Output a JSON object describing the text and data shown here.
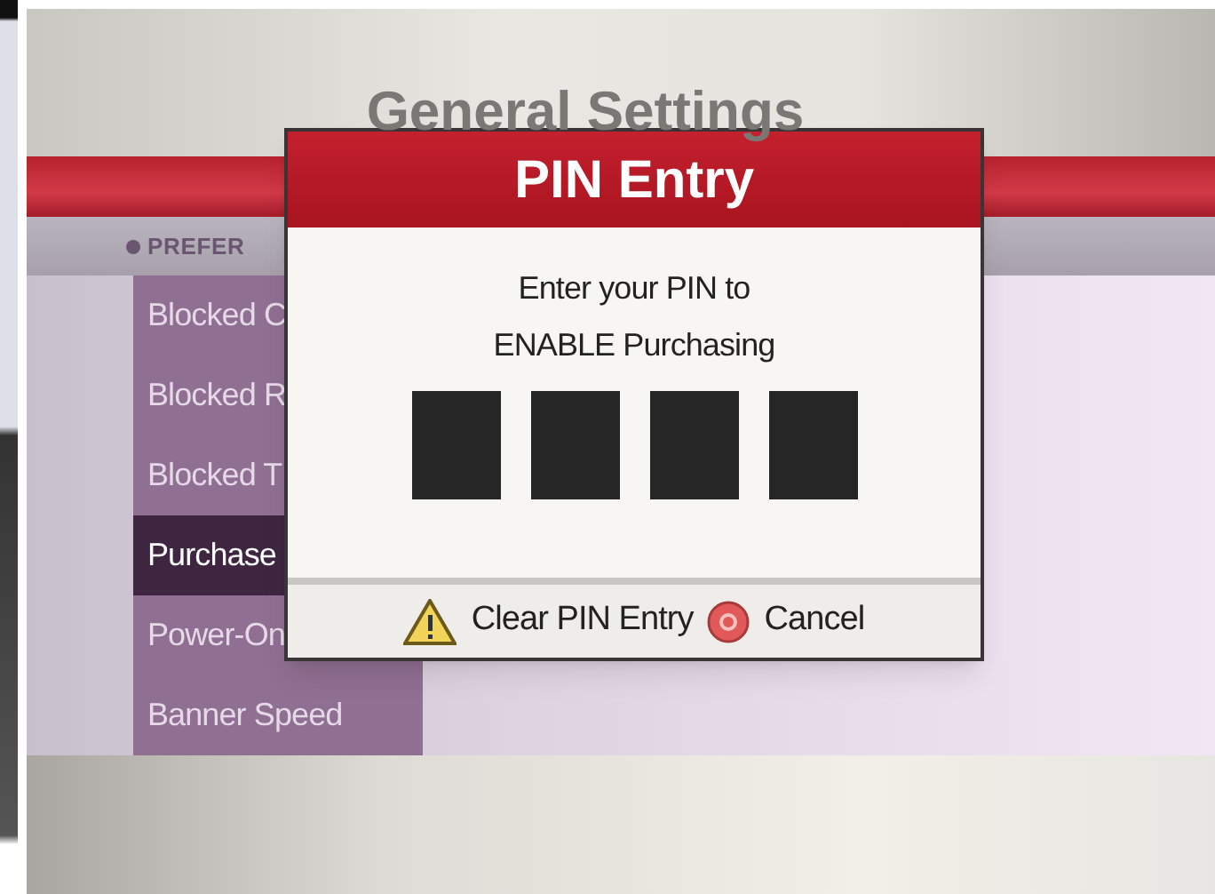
{
  "screen_title": "General Settings",
  "section_label": "PREFER",
  "menu": [
    {
      "label": "Blocked C",
      "selected": false
    },
    {
      "label": "Blocked R",
      "selected": false
    },
    {
      "label": "Blocked T",
      "selected": false
    },
    {
      "label": "Purchase",
      "selected": true
    },
    {
      "label": "Power-On",
      "selected": false
    },
    {
      "label": "Banner Speed",
      "selected": false
    }
  ],
  "dialog": {
    "title": "PIN Entry",
    "prompt": [
      "Enter your PIN to",
      "ENABLE Purchasing"
    ],
    "pin_digits": [
      {
        "filled": false
      },
      {
        "filled": false
      },
      {
        "filled": false
      },
      {
        "filled": false
      }
    ],
    "actions": [
      {
        "kind": "warning",
        "label": "Clear PIN Entry"
      },
      {
        "kind": "cancel",
        "label": "Cancel"
      }
    ]
  }
}
